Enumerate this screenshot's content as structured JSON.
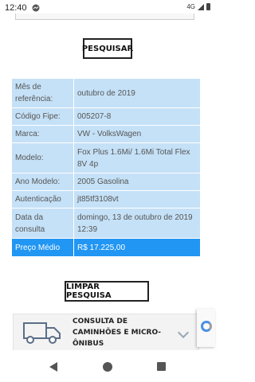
{
  "status_bar": {
    "time": "12:40",
    "network": "4G"
  },
  "buttons": {
    "search": "PESQUISAR",
    "clear": "LIMPAR PESQUISA"
  },
  "results": [
    {
      "label": "Mês de referência:",
      "value": "outubro de 2019"
    },
    {
      "label": "Código Fipe:",
      "value": "005207-8"
    },
    {
      "label": "Marca:",
      "value": "VW - VolksWagen"
    },
    {
      "label": "Modelo:",
      "value": "Fox Plus 1.6Mi/ 1.6Mi Total Flex 8V 4p"
    },
    {
      "label": "Ano Modelo:",
      "value": "2005 Gasolina"
    },
    {
      "label": "Autenticação",
      "value": "jt85tf3108vt"
    },
    {
      "label": "Data da consulta",
      "value": "domingo, 13 de outubro de 2019 12:39"
    }
  ],
  "price": {
    "label": "Preço Médio",
    "value": "R$ 17.225,00"
  },
  "accordion": {
    "label": "CONSULTA DE CAMINHÕES E MICRO-ÔNIBUS",
    "icon": "truck-icon"
  },
  "colors": {
    "table_bg": "#c5e1f7",
    "price_bg": "#2196f3"
  }
}
